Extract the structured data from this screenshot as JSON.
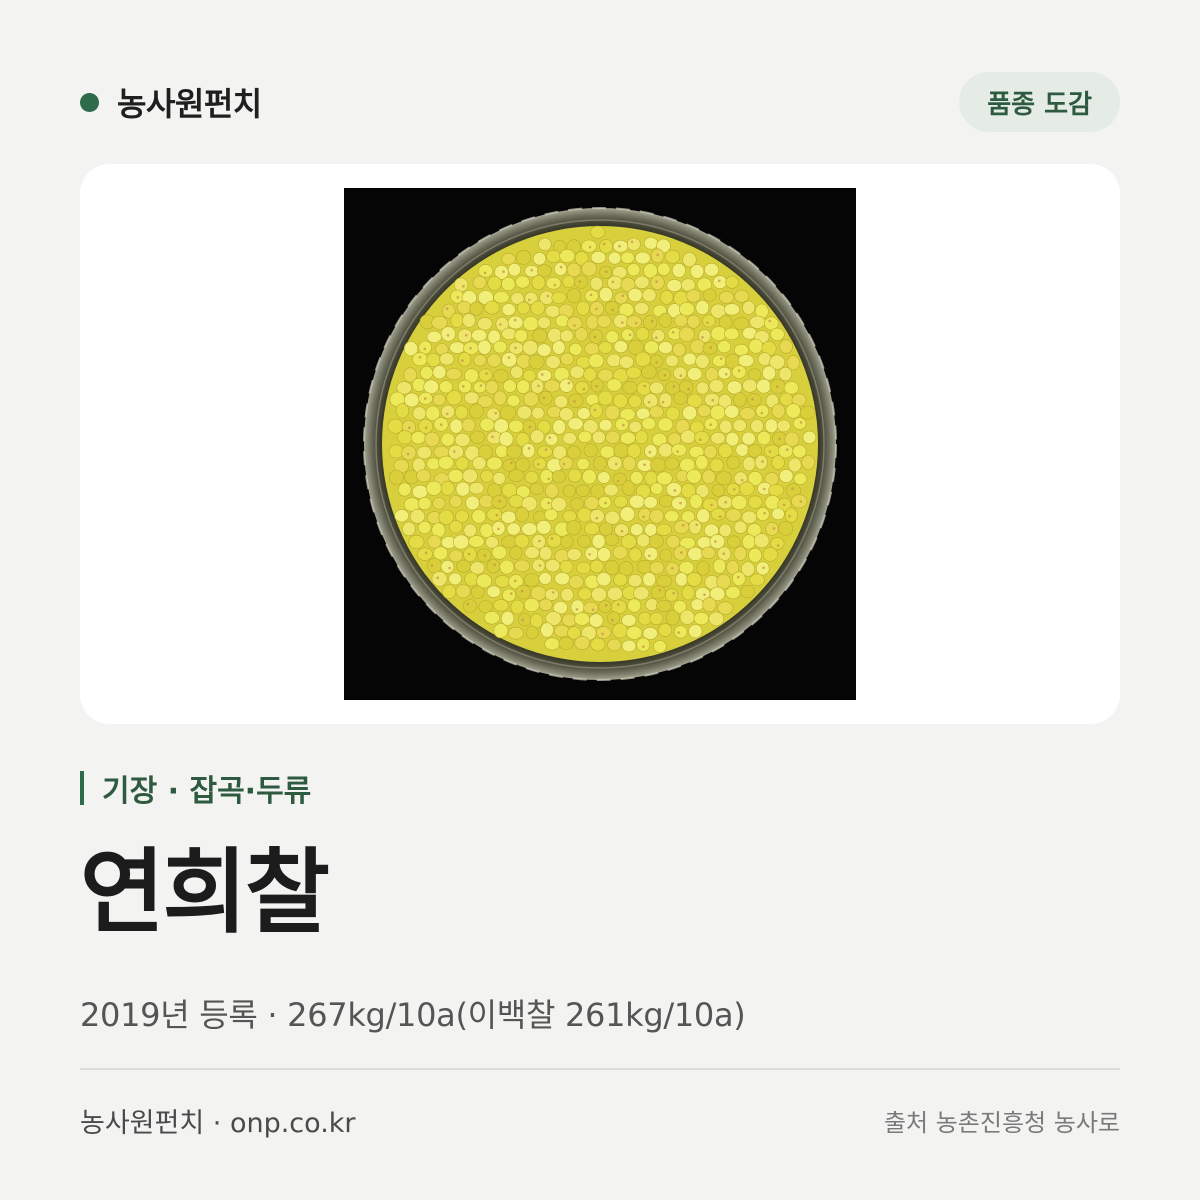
{
  "header": {
    "brand": "농사원펀치",
    "badge": "품종 도감"
  },
  "image": {
    "subject": "yellow millet grains in a glass dish",
    "background_color": "#050505",
    "grain_color": "#e6e04e"
  },
  "category": "기장 · 잡곡·두류",
  "title": "연희찰",
  "meta": "2019년 등록 · 267kg/10a(이백찰 261kg/10a)",
  "footer": {
    "left": "농사원펀치 · onp.co.kr",
    "right": "출처 농촌진흥청 농사로"
  },
  "colors": {
    "accent": "#2e6b4a",
    "badge_bg": "#e5ece6",
    "page_bg": "#f3f3f1"
  }
}
